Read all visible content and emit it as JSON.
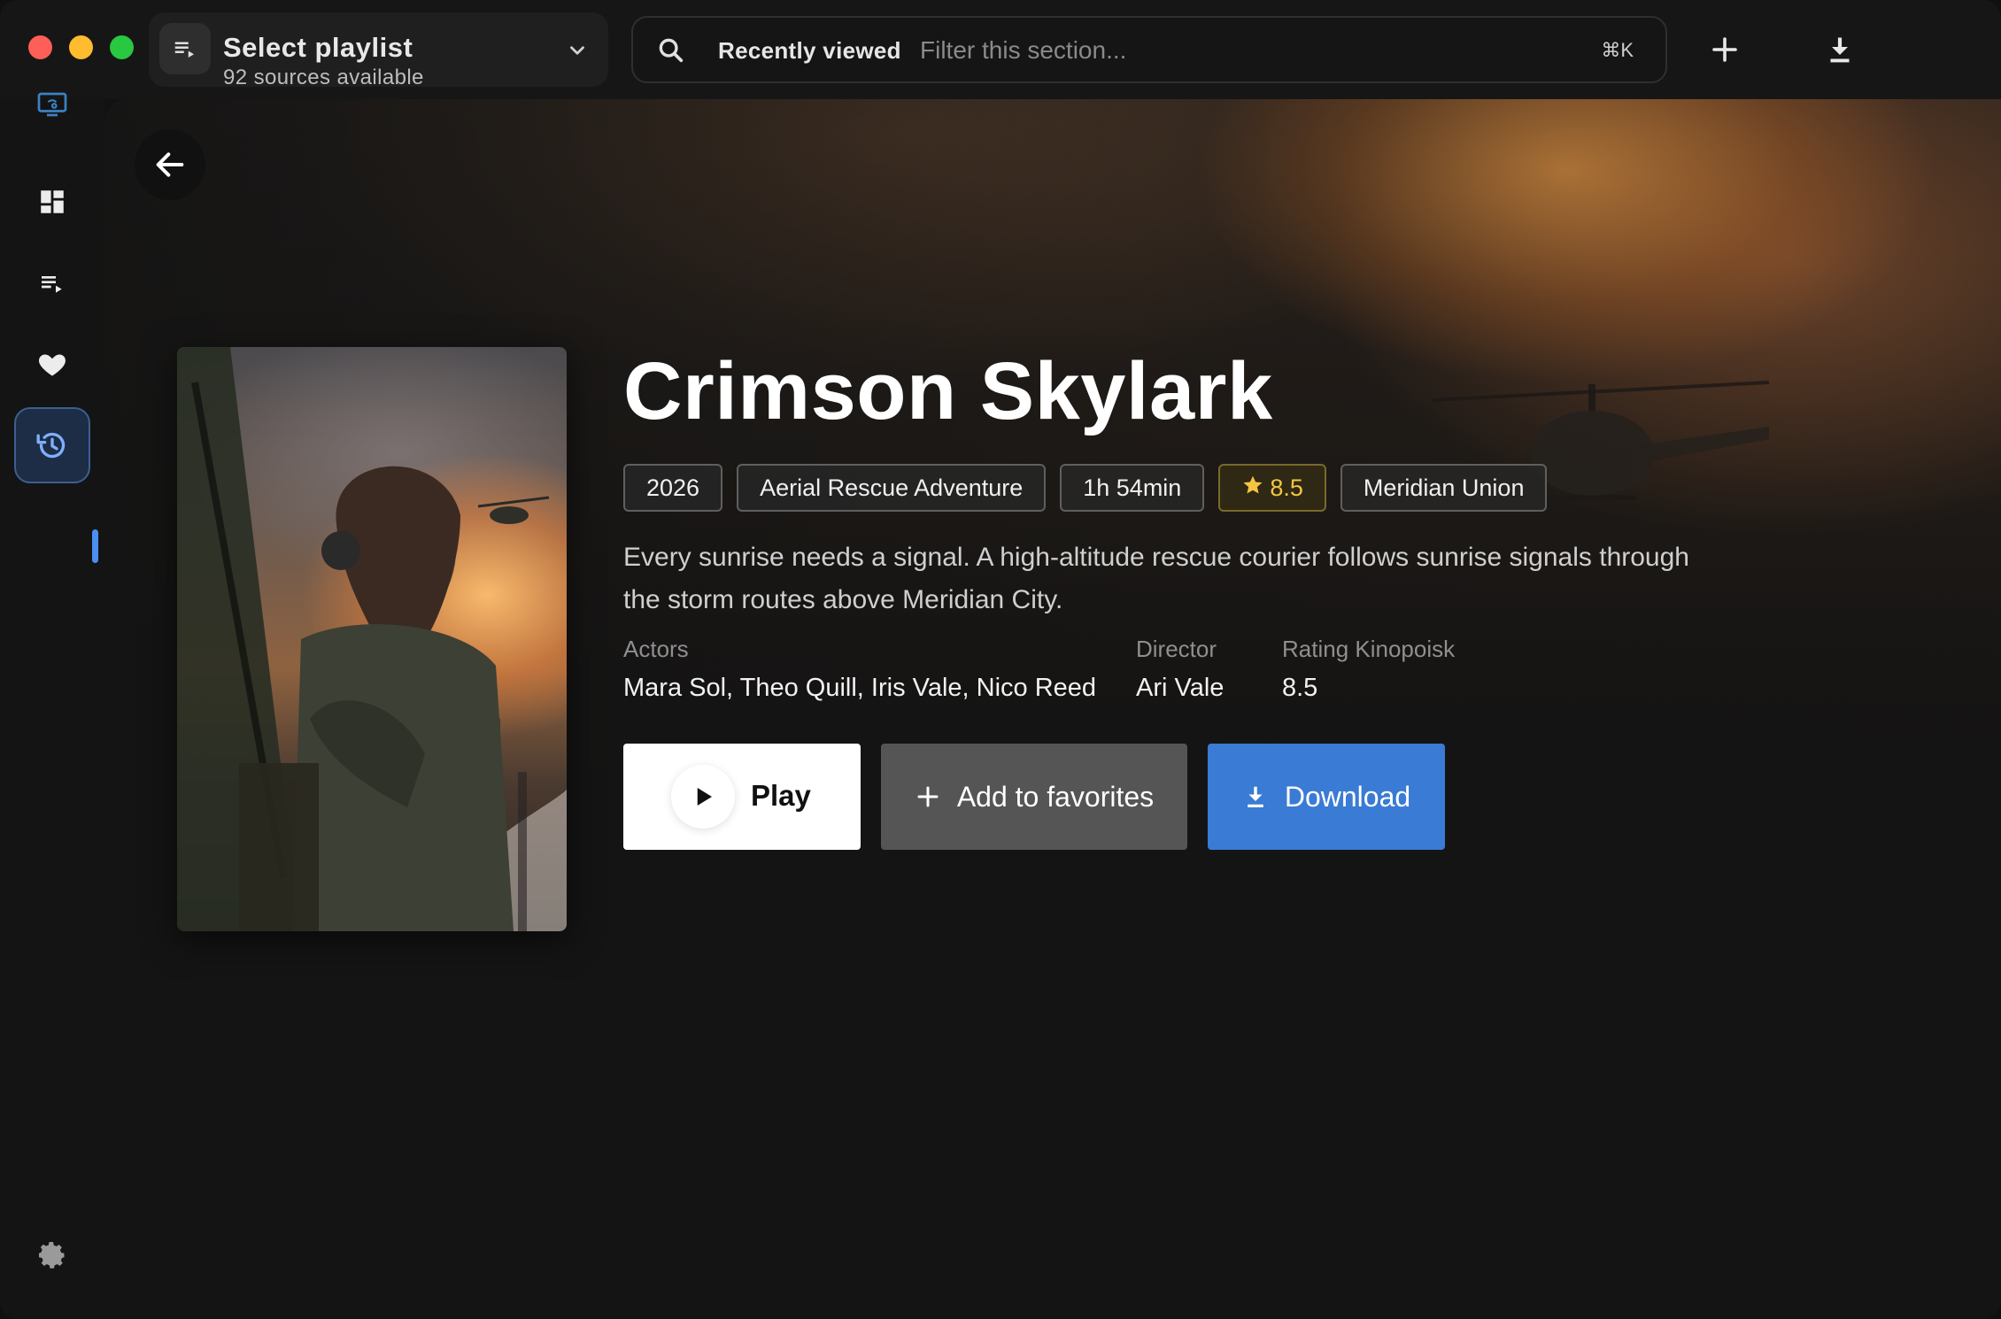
{
  "header": {
    "playlist_title": "Select playlist",
    "playlist_subtitle": "92 sources available",
    "search_section": "Recently viewed",
    "search_placeholder": "Filter this section...",
    "search_shortcut": "⌘K"
  },
  "movie": {
    "title": "Crimson Skylark",
    "tags": {
      "year": "2026",
      "genre": "Aerial Rescue Adventure",
      "duration": "1h 54min",
      "rating": "8.5",
      "studio": "Meridian Union"
    },
    "description": "Every sunrise needs a signal. A high-altitude rescue courier follows sunrise signals through the storm routes above Meridian City.",
    "actors_label": "Actors",
    "actors": "Mara Sol, Theo Quill, Iris Vale, Nico Reed",
    "director_label": "Director",
    "director": "Ari Vale",
    "kinopoisk_label": "Rating Kinopoisk",
    "kinopoisk": "8.5"
  },
  "actions": {
    "play": "Play",
    "favorites": "Add to favorites",
    "download": "Download"
  },
  "colors": {
    "accent": "#3a7bd5",
    "rating": "#f5c542",
    "active_nav": "#4b8ef2"
  },
  "icons": {
    "sidebar": [
      "tv-icon",
      "dashboard-icon",
      "playlist-icon",
      "heart-icon",
      "history-icon",
      "gear-icon"
    ],
    "topbar": [
      "playlist-icon",
      "chevron-down-icon",
      "search-icon",
      "plus-icon",
      "download-icon"
    ]
  }
}
